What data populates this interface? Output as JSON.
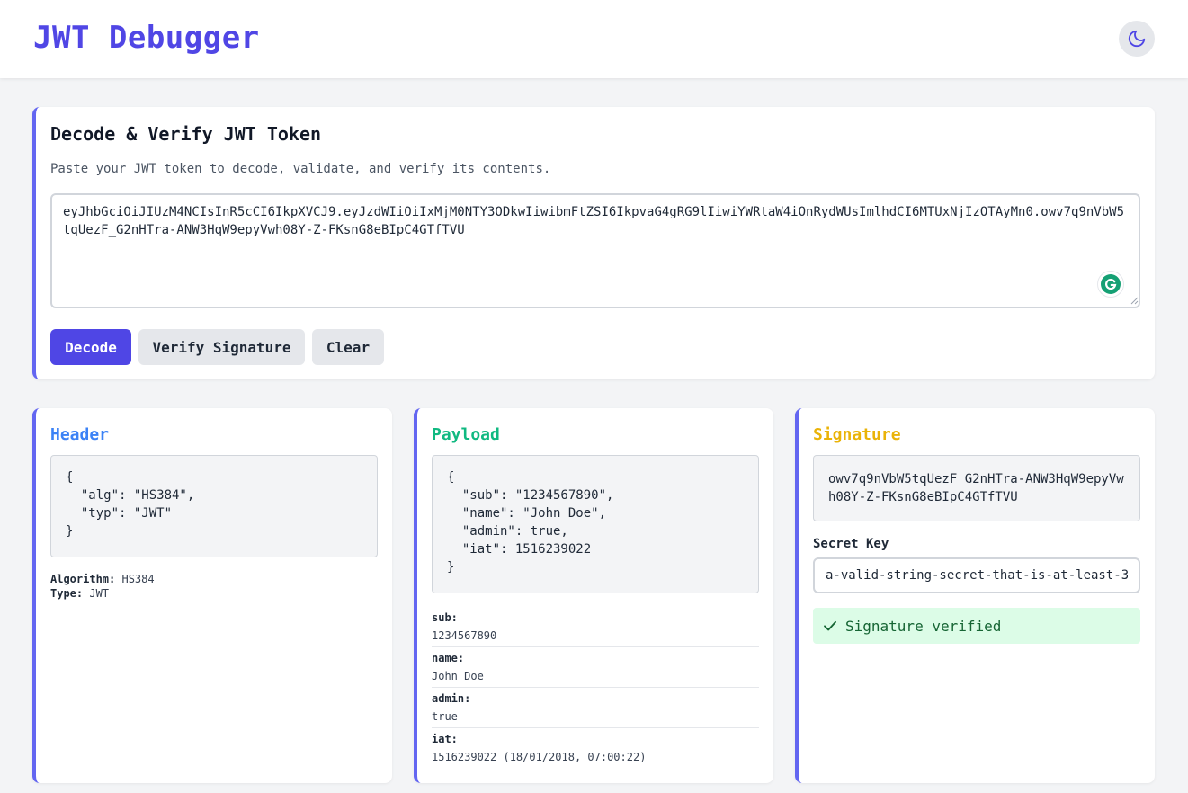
{
  "app": {
    "title": "JWT Debugger"
  },
  "colors": {
    "accent": "#4f46e5",
    "header": "#3b82f6",
    "payload": "#10b981",
    "signature": "#eab308",
    "verified_bg": "#dcfce7"
  },
  "decoder": {
    "title": "Decode & Verify JWT Token",
    "description": "Paste your JWT token to decode, validate, and verify its contents.",
    "token": "eyJhbGciOiJIUzM4NCIsInR5cCI6IkpXVCJ9.eyJzdWIiOiIxMjM0NTY3ODkwIiwibmFtZSI6IkpvaG4gRG9lIiwiYWRtaW4iOnRydWUsImlhdCI6MTUxNjIzOTAyMn0.owv7q9nVbW5tqUezF_G2nHTra-ANW3HqW9epyVwh08Y-Z-FKsnG8eBIpC4GTfTVU",
    "buttons": {
      "decode": "Decode",
      "verify": "Verify Signature",
      "clear": "Clear"
    }
  },
  "header_panel": {
    "title": "Header",
    "json": "{\n  \"alg\": \"HS384\",\n  \"typ\": \"JWT\"\n}",
    "algorithm_label": "Algorithm:",
    "algorithm": "HS384",
    "type_label": "Type:",
    "type": "JWT"
  },
  "payload_panel": {
    "title": "Payload",
    "json": "{\n  \"sub\": \"1234567890\",\n  \"name\": \"John Doe\",\n  \"admin\": true,\n  \"iat\": 1516239022\n}",
    "claims": [
      {
        "key": "sub:",
        "value": "1234567890"
      },
      {
        "key": "name:",
        "value": "John Doe"
      },
      {
        "key": "admin:",
        "value": "true"
      },
      {
        "key": "iat:",
        "value": "1516239022 (18/01/2018, 07:00:22)"
      }
    ]
  },
  "signature_panel": {
    "title": "Signature",
    "value": "owv7q9nVbW5tqUezF_G2nHTra-ANW3HqW9epyVwh08Y-Z-FKsnG8eBIpC4GTfTVU",
    "secret_label": "Secret Key",
    "secret_value": "a-valid-string-secret-that-is-at-least-3",
    "status": "Signature verified"
  }
}
